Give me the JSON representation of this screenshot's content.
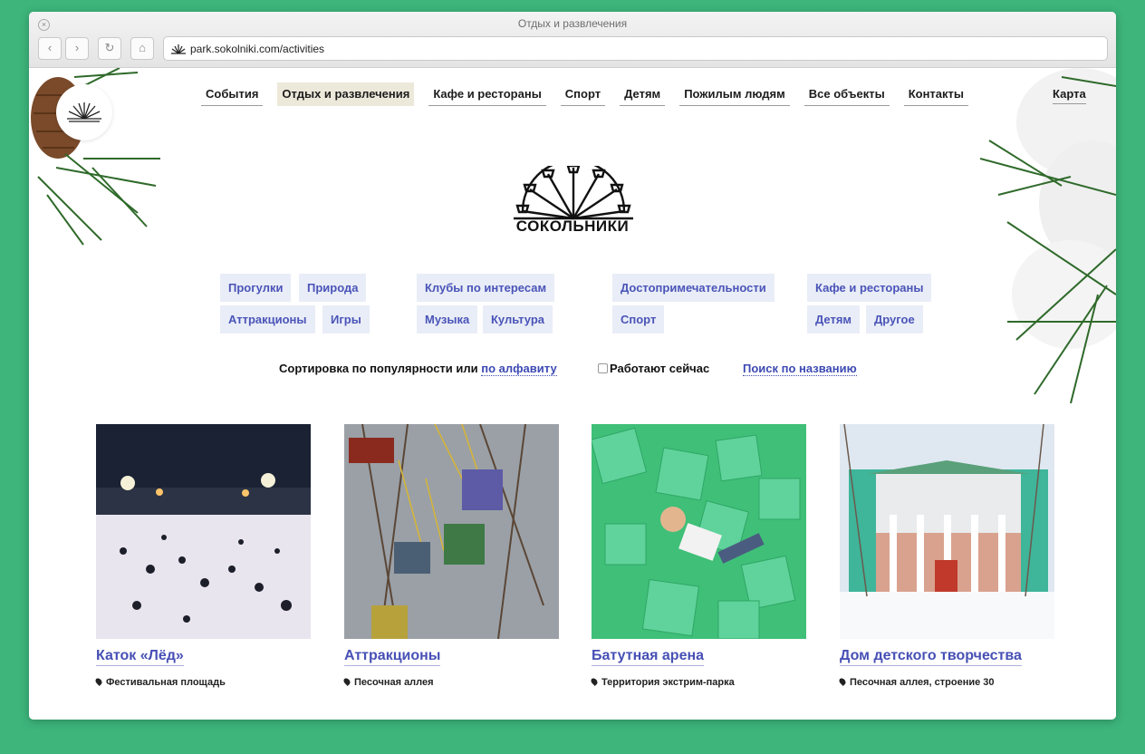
{
  "browser": {
    "window_title": "Отдых и развлечения",
    "url": "park.sokolniki.com/activities"
  },
  "nav": {
    "items": [
      {
        "label": "События",
        "active": false
      },
      {
        "label": "Отдых и развлечения",
        "active": true
      },
      {
        "label": "Кафе и рестораны",
        "active": false
      },
      {
        "label": "Спорт",
        "active": false
      },
      {
        "label": "Детям",
        "active": false
      },
      {
        "label": "Пожилым людям",
        "active": false
      },
      {
        "label": "Все объекты",
        "active": false
      },
      {
        "label": "Контакты",
        "active": false
      }
    ],
    "map_label": "Карта"
  },
  "logo": {
    "text": "СОКОЛЬНИКИ"
  },
  "categories": [
    "Прогулки",
    "Природа",
    "Аттракционы",
    "Игры",
    "Клубы по интересам",
    "Музыка",
    "Культура",
    "Достопримечательности",
    "Спорт",
    "Кафе и рестораны",
    "Детям",
    "Другое"
  ],
  "sort": {
    "prefix": "Сортировка по популярности или",
    "alpha_link": "по алфавиту",
    "open_now": "Работают сейчас",
    "search_link": "Поиск по названию"
  },
  "cards": [
    {
      "title": "Каток «Лёд»",
      "location": "Фестивальная площадь"
    },
    {
      "title": "Аттракционы",
      "location": "Песочная аллея"
    },
    {
      "title": "Батутная арена",
      "location": "Территория экстрим-парка"
    },
    {
      "title": "Дом детского творчества",
      "location": "Песочная аллея, строение 30"
    }
  ],
  "colors": {
    "background": "#3db57b",
    "link": "#4750b5",
    "category_bg": "#e9edf7",
    "active_nav_bg": "#ede9da"
  },
  "icons": {
    "close": "close-icon",
    "back": "chevron-left-icon",
    "forward": "chevron-right-icon",
    "reload": "reload-icon",
    "home": "home-icon",
    "site": "sokolniki-fan-icon",
    "location": "map-pin-icon"
  }
}
